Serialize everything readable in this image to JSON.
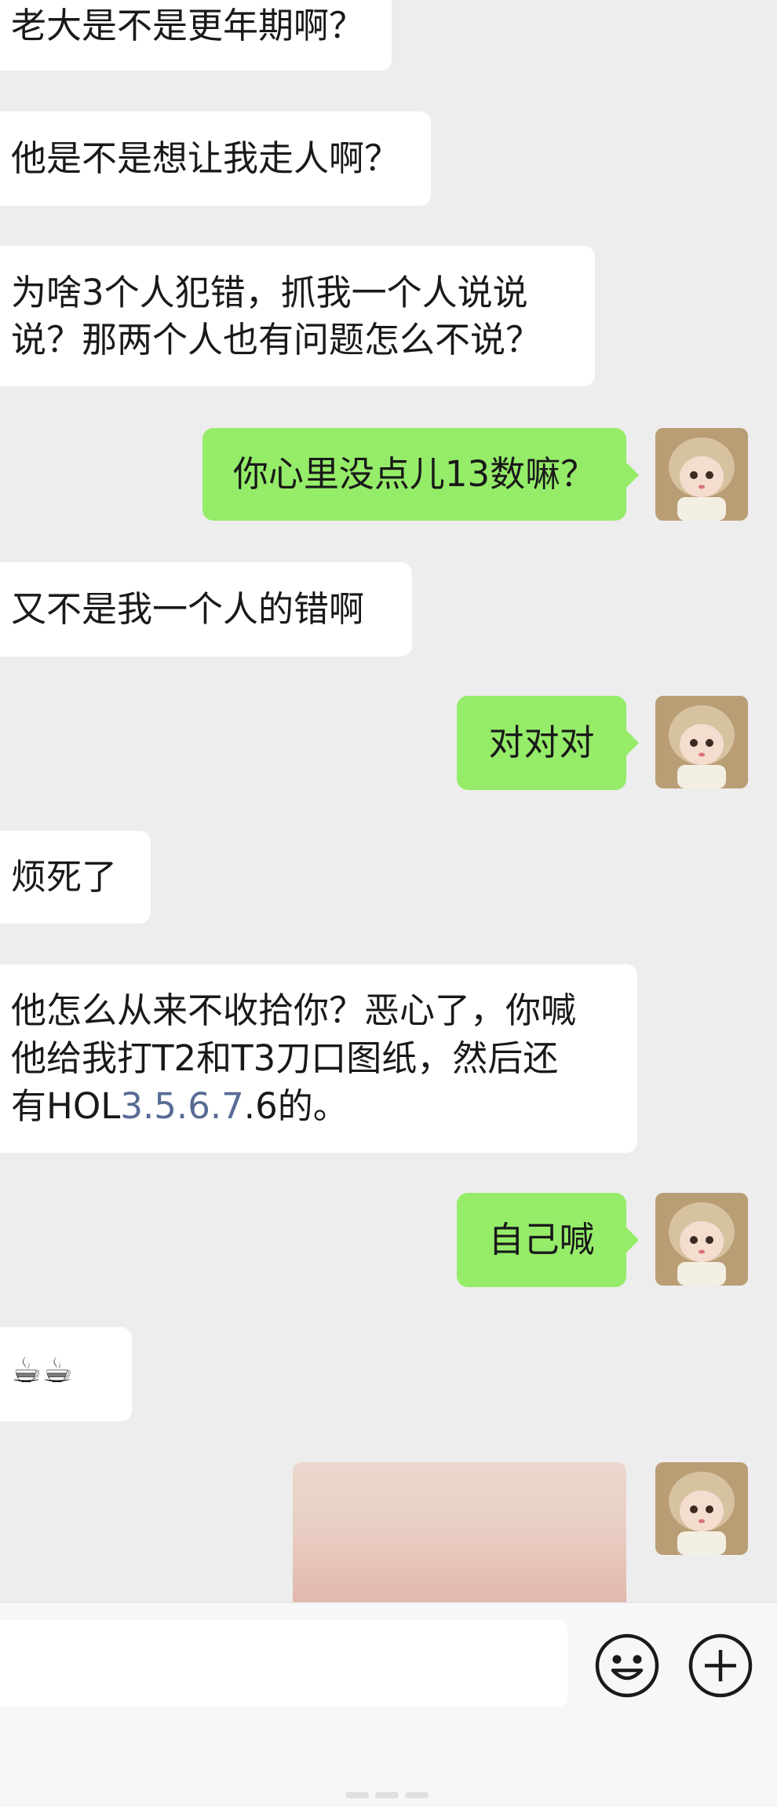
{
  "chat": {
    "messages": [
      {
        "side": "left",
        "lines": [
          "老大是不是更年期啊？"
        ]
      },
      {
        "side": "left",
        "lines": [
          "他是不是想让我走人啊？"
        ]
      },
      {
        "side": "left",
        "lines": [
          "为啥3个人犯错，抓我一个人说说",
          "说？那两个人也有问题怎么不说？"
        ]
      },
      {
        "side": "right",
        "lines": [
          "你心里没点儿13数嘛？"
        ]
      },
      {
        "side": "left",
        "lines": [
          "又不是我一个人的错啊"
        ]
      },
      {
        "side": "right",
        "lines": [
          "对对对"
        ]
      },
      {
        "side": "left",
        "lines": [
          "烦死了"
        ]
      },
      {
        "side": "left",
        "lines": [
          "他怎么从来不收拾你？恶心了，你喊",
          "他给我打T2和T3刀口图纸，然后还"
        ],
        "last_line": {
          "before": "有HOL",
          "link": "3.5.6.7",
          "after": ".6的。"
        }
      },
      {
        "side": "right",
        "lines": [
          "自己喊"
        ]
      },
      {
        "side": "left",
        "emoji": "☕☕"
      }
    ]
  },
  "colors": {
    "background": "#ededed",
    "incoming": "#ffffff",
    "outgoing": "#95ec69",
    "link": "#576b95"
  },
  "input_bar": {
    "placeholder": "",
    "emoji_button": "smiley-icon",
    "plus_button": "plus-icon"
  }
}
